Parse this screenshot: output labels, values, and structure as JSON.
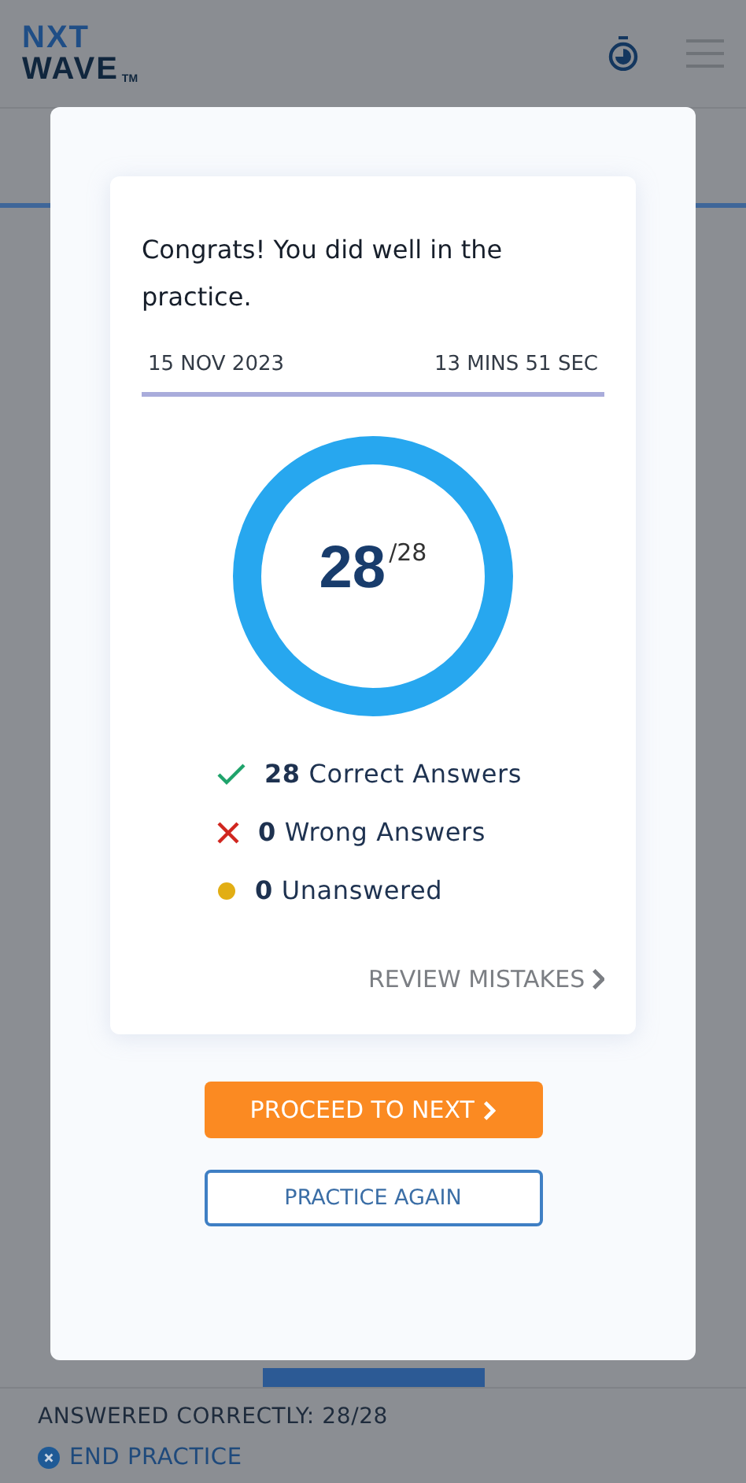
{
  "header": {
    "logo": {
      "line_1": "NXT",
      "line_2": "WAVE",
      "mark": "TM"
    }
  },
  "result_modal": {
    "message": "Congrats! You did well in the practice.",
    "date": "15 NOV 2023",
    "duration": "13 MINS 51 SEC",
    "score": {
      "value": "28",
      "total": "/28",
      "level": 1
    },
    "stats": [
      {
        "kind": "correct",
        "count": "28",
        "label": "Correct Answers"
      },
      {
        "kind": "wrong",
        "count": "0",
        "label": "Wrong Answers"
      },
      {
        "kind": "unanswered",
        "count": "0",
        "label": "Unanswered"
      }
    ],
    "review_link": "REVIEW MISTAKES",
    "primary_button": "PROCEED TO NEXT",
    "secondary_button": "PRACTICE AGAIN"
  },
  "footer": {
    "summary": "ANSWERED CORRECTLY: 28/28",
    "end_button": "END PRACTICE"
  }
}
